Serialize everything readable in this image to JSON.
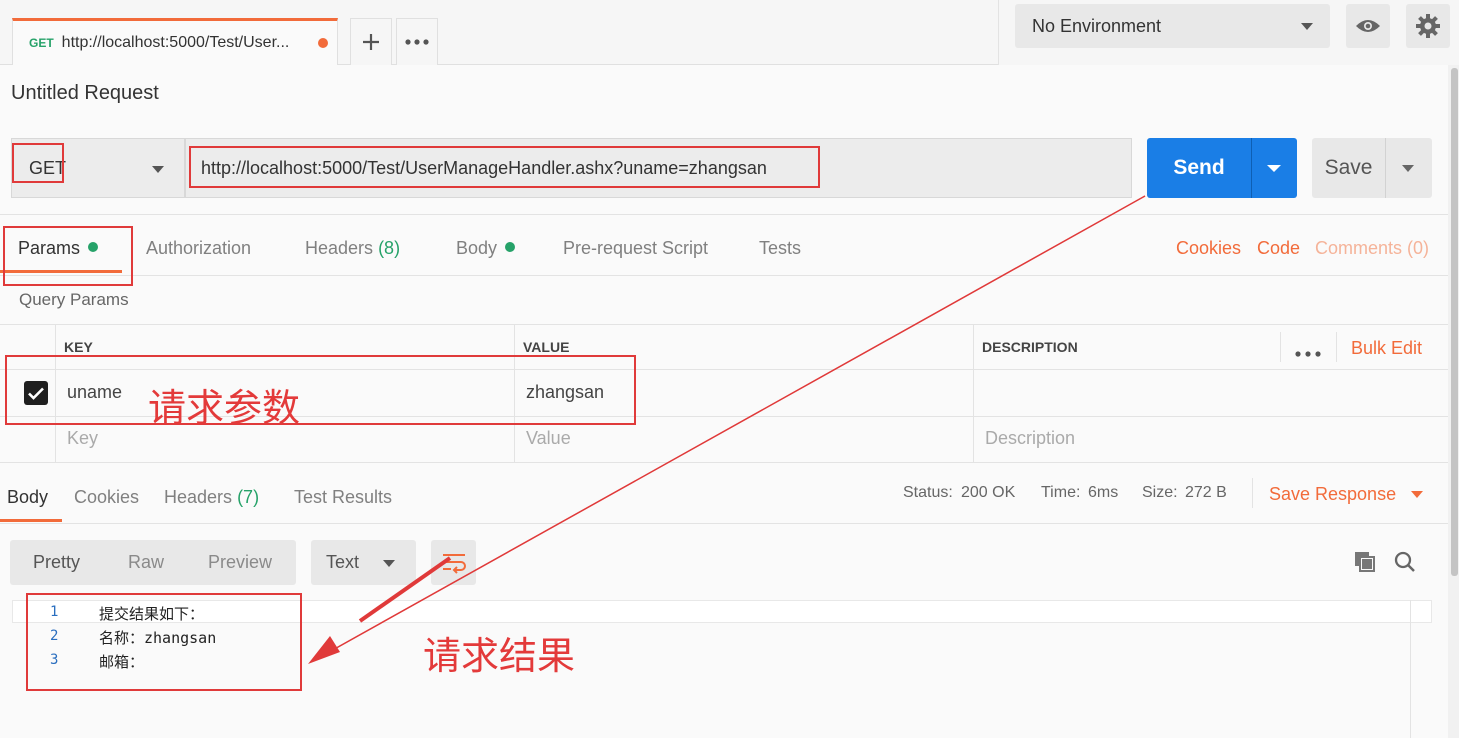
{
  "tab": {
    "method": "GET",
    "url": "http://localhost:5000/Test/User..."
  },
  "environment": {
    "selected": "No Environment"
  },
  "request": {
    "title": "Untitled Request",
    "method": "GET",
    "url": "http://localhost:5000/Test/UserManageHandler.ashx?uname=zhangsan",
    "send_label": "Send",
    "save_label": "Save"
  },
  "request_tabs": {
    "params": "Params",
    "authorization": "Authorization",
    "headers": "Headers",
    "headers_count": "(8)",
    "body": "Body",
    "prerequest": "Pre-request Script",
    "tests": "Tests",
    "cookies": "Cookies",
    "code": "Code",
    "comments": "Comments (0)"
  },
  "query_params": {
    "title": "Query Params",
    "columns": [
      "KEY",
      "VALUE",
      "DESCRIPTION"
    ],
    "bulk_edit": "Bulk Edit",
    "rows": [
      {
        "key": "uname",
        "value": "zhangsan",
        "checked": true
      }
    ],
    "placeholders": {
      "key": "Key",
      "value": "Value",
      "description": "Description"
    }
  },
  "response": {
    "tabs": {
      "body": "Body",
      "cookies": "Cookies",
      "headers": "Headers",
      "headers_count": "(7)",
      "test_results": "Test Results"
    },
    "status_label": "Status:",
    "status": "200 OK",
    "time_label": "Time:",
    "time": "6ms",
    "size_label": "Size:",
    "size": "272 B",
    "save_response": "Save Response",
    "formats": [
      "Pretty",
      "Raw",
      "Preview"
    ],
    "type": "Text",
    "lines": [
      {
        "n": "1",
        "text": "提交结果如下："
      },
      {
        "n": "2",
        "text": "名称：zhangsan"
      },
      {
        "n": "3",
        "text": "邮箱："
      }
    ]
  },
  "annotations": {
    "params_note": "请求参数",
    "result_note": "请求结果"
  },
  "colors": {
    "accent": "#f26b3a",
    "send": "#1a7ee6",
    "success": "#26a269",
    "annotation": "#e03a3a"
  }
}
